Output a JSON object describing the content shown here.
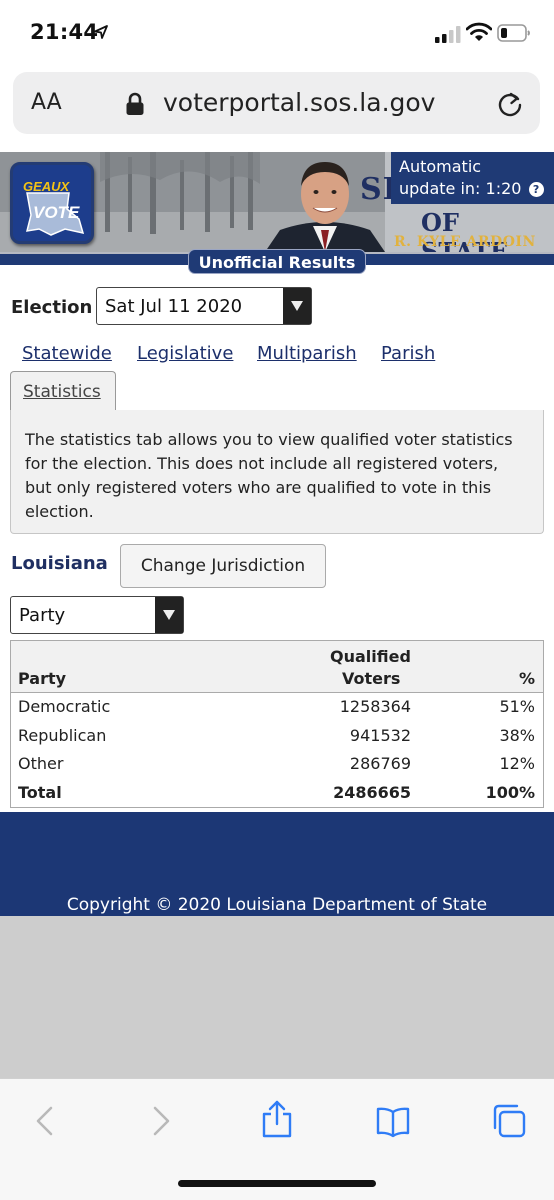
{
  "status_bar": {
    "time": "21:44"
  },
  "browser": {
    "aa_label": "AA",
    "url": "voterportal.sos.la.gov"
  },
  "banner": {
    "logo_top": "GEAUX",
    "logo_bottom": "VOTE",
    "title": "SECRETARY",
    "subtitle": "OF STATE",
    "name": "R. KYLE ARDOIN",
    "update_label": "Automatic",
    "update_line": "update in: 1:20",
    "update_help": "?",
    "results_tab": "Unofficial Results"
  },
  "election": {
    "label": "Election",
    "selected": "Sat Jul 11 2020"
  },
  "nav": {
    "links": [
      "Statewide",
      "Legislative",
      "Multiparish",
      "Parish"
    ],
    "active_tab": "Statistics"
  },
  "info_text": "The statistics tab allows you to view qualified voter statistics for the election. This does not include all registered voters, but only registered voters who are qualified to vote in this election.",
  "jurisdiction": {
    "label": "Louisiana",
    "button": "Change Jurisdiction"
  },
  "filter": {
    "selected": "Party"
  },
  "table": {
    "headers": {
      "party": "Party",
      "qualified_line1": "Qualified",
      "qualified_line2": "Voters",
      "percent": "%"
    },
    "rows": [
      {
        "party": "Democratic",
        "voters": "1258364",
        "percent": "51%"
      },
      {
        "party": "Republican",
        "voters": "941532",
        "percent": "38%"
      },
      {
        "party": "Other",
        "voters": "286769",
        "percent": "12%"
      },
      {
        "party": "Total",
        "voters": "2486665",
        "percent": "100%"
      }
    ]
  },
  "footer": {
    "copyright": "Copyright © 2020 Louisiana Department of State"
  },
  "colors": {
    "navy": "#1f3a75",
    "footer_navy": "#1c3775",
    "ios_blue": "#2f7cf6",
    "gold": "#e1b23f"
  }
}
